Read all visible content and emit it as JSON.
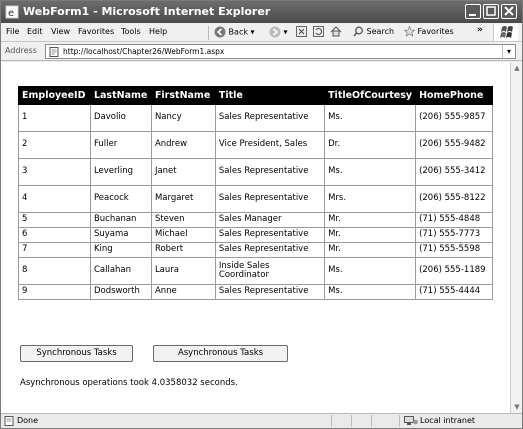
{
  "window": {
    "title": "WebForm1 - Microsoft Internet Explorer"
  },
  "menu": {
    "items": [
      "File",
      "Edit",
      "View",
      "Favorites",
      "Tools",
      "Help"
    ],
    "back_label": "Back",
    "search_label": "Search",
    "favorites_label": "Favorites",
    "overflow": "»"
  },
  "address": {
    "label": "Address",
    "url": "http://localhost/Chapter26/WebForm1.aspx"
  },
  "table": {
    "headers": [
      "EmployeeID",
      "LastName",
      "FirstName",
      "Title",
      "TitleOfCourtesy",
      "HomePhone"
    ],
    "rows": [
      [
        "1",
        "Davolio",
        "Nancy",
        "Sales Representative",
        "Ms.",
        "(206) 555-9857"
      ],
      [
        "2",
        "Fuller",
        "Andrew",
        "Vice President, Sales",
        "Dr.",
        "(206) 555-9482"
      ],
      [
        "3",
        "Leverling",
        "Janet",
        "Sales Representative",
        "Ms.",
        "(206) 555-3412"
      ],
      [
        "4",
        "Peacock",
        "Margaret",
        "Sales Representative",
        "Mrs.",
        "(206) 555-8122"
      ],
      [
        "5",
        "Buchanan",
        "Steven",
        "Sales Manager",
        "Mr.",
        "(71) 555-4848"
      ],
      [
        "6",
        "Suyama",
        "Michael",
        "Sales Representative",
        "Mr.",
        "(71) 555-7773"
      ],
      [
        "7",
        "King",
        "Robert",
        "Sales Representative",
        "Mr.",
        "(71) 555-5598"
      ],
      [
        "8",
        "Callahan",
        "Laura",
        "Inside Sales Coordinator",
        "Ms.",
        "(206) 555-1189"
      ],
      [
        "9",
        "Dodsworth",
        "Anne",
        "Sales Representative",
        "Ms.",
        "(71) 555-4444"
      ]
    ]
  },
  "buttons": {
    "sync": "Synchronous Tasks",
    "async": "Asynchronous Tasks"
  },
  "result_message": "Asynchronous operations took 4.0358032 seconds.",
  "status": {
    "text": "Done",
    "zone": "Local intranet"
  }
}
